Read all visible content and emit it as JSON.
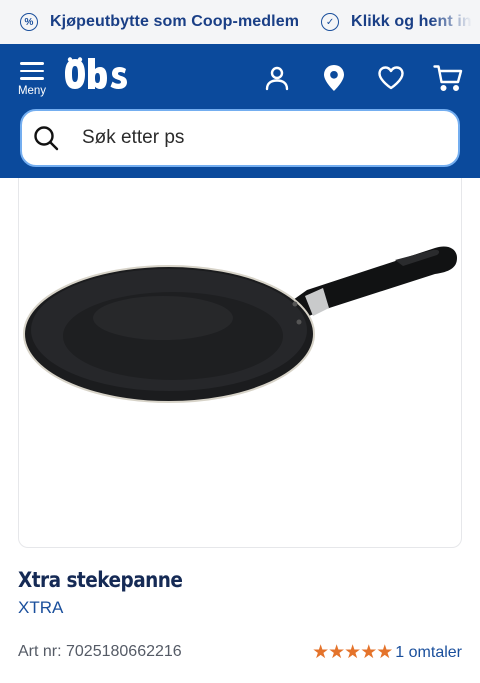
{
  "promo": {
    "items": [
      {
        "icon": "percent-badge-icon",
        "text": "Kjøpeutbytte som Coop-medlem"
      },
      {
        "icon": "check-circle-icon",
        "text": "Klikk og hent inne"
      }
    ]
  },
  "header": {
    "menu_label": "Meny",
    "logo_text": "Obs",
    "icons": [
      "user-icon",
      "location-pin-icon",
      "heart-icon",
      "cart-icon"
    ],
    "background": "#0b4a9c"
  },
  "search": {
    "value": "Søk etter ps"
  },
  "product": {
    "title": "Xtra stekepanne",
    "brand": "XTRA",
    "art_nr": "Art nr: 7025180662216",
    "rating": 5,
    "reviews": "1 omtaler",
    "star_color": "#e4732b"
  }
}
